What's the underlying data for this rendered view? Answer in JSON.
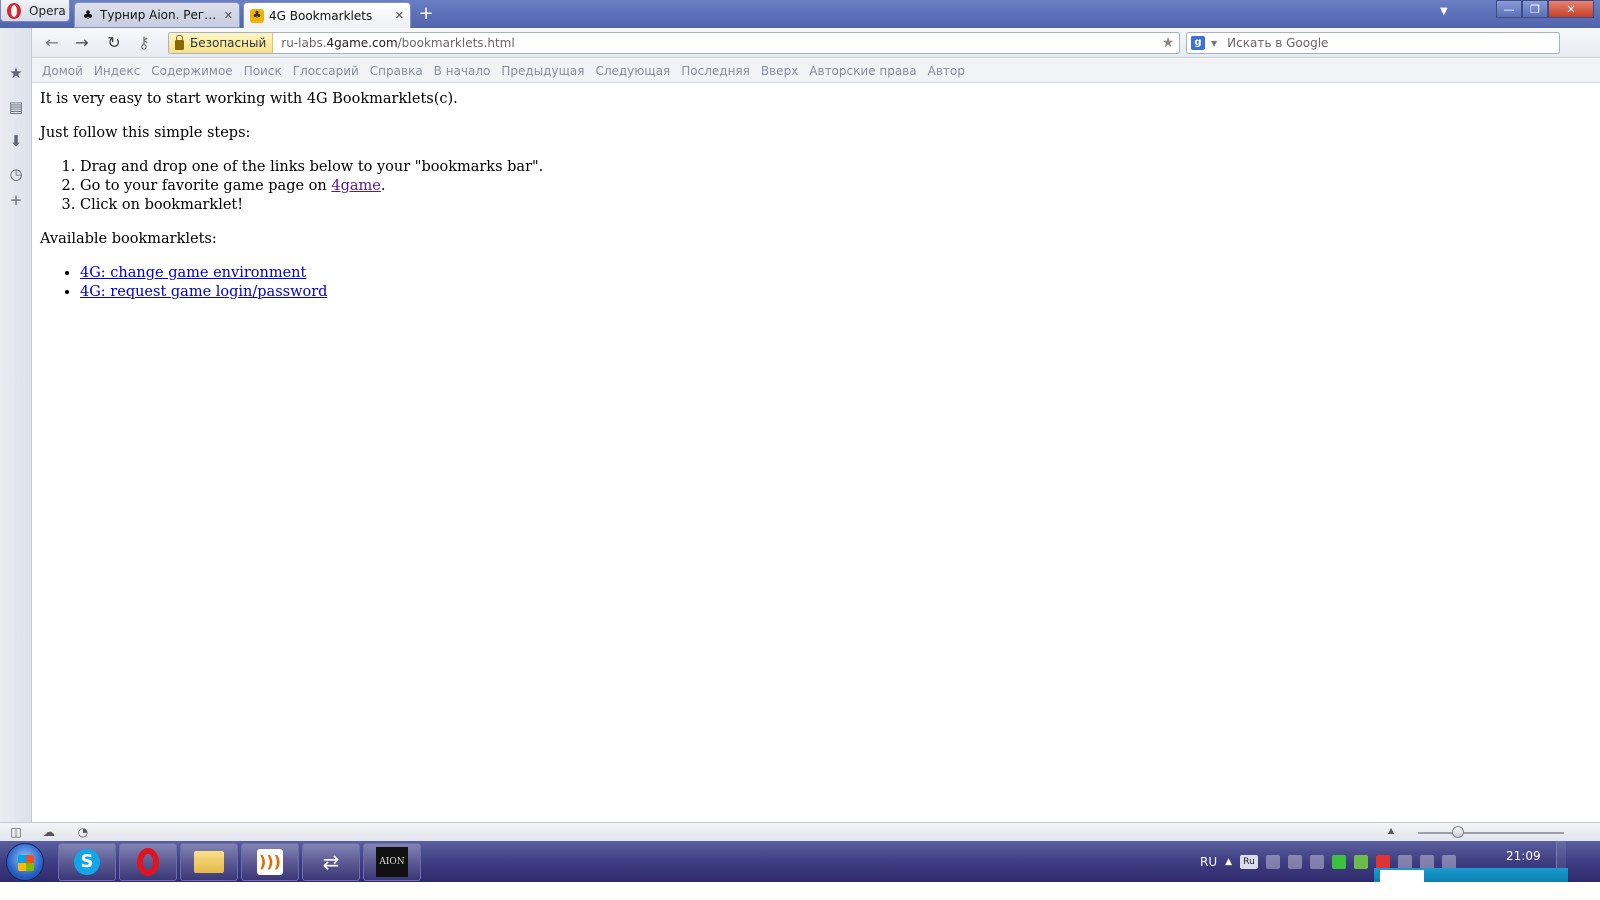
{
  "browser": {
    "menu_label": "Opera",
    "tabs": [
      {
        "title": "Турнир Aion. Регистр...",
        "close": "✕"
      },
      {
        "title": "4G Bookmarklets",
        "close": "✕"
      }
    ],
    "new_tab": "+",
    "tab_menu": "▼",
    "window_controls": {
      "minimize": "—",
      "maximize": "❐",
      "close": "✕"
    }
  },
  "addressbar": {
    "security_label": "Безопасный",
    "url_prefix": "ru-labs.",
    "url_domain": "4game.com",
    "url_path": "/bookmarklets.html",
    "search_engine_letter": "g",
    "search_placeholder": "Искать в Google"
  },
  "navbar": {
    "links": [
      "Домой",
      "Индекс",
      "Содержимое",
      "Поиск",
      "Глоссарий",
      "Справка",
      "В начало",
      "Предыдущая",
      "Следующая",
      "Последняя",
      "Вверх",
      "Авторские права",
      "Автор"
    ]
  },
  "page": {
    "intro": "It is very easy to start working with 4G Bookmarklets(c).",
    "steps_heading": "Just follow this simple steps:",
    "step1": "Drag and drop one of the links below to your \"bookmarks bar\".",
    "step2_before": "Go to your favorite game page on ",
    "step2_link": "4game",
    "step2_after": ".",
    "step3": "Click on bookmarklet!",
    "available_heading": "Available bookmarklets:",
    "bookmarklets": [
      "4G: change game environment",
      "4G: request game login/password"
    ]
  },
  "taskbar": {
    "skype_letter": "S",
    "aion_label": "AION",
    "language": "RU",
    "lang_badge": "Ru",
    "clock": "21:09"
  }
}
